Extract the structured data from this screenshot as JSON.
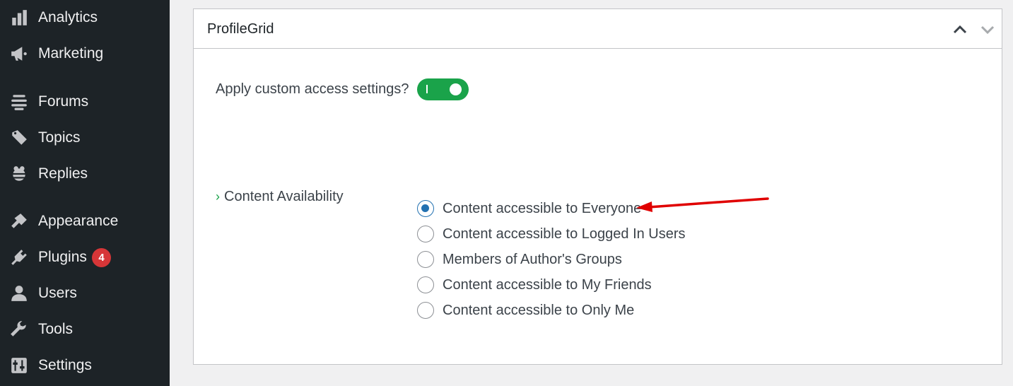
{
  "sidebar": {
    "items": [
      {
        "label": "Analytics",
        "icon": "bar-chart-icon"
      },
      {
        "label": "Marketing",
        "icon": "megaphone-icon"
      },
      {
        "label": "Forums",
        "icon": "forums-icon"
      },
      {
        "label": "Topics",
        "icon": "topics-icon"
      },
      {
        "label": "Replies",
        "icon": "replies-icon"
      },
      {
        "label": "Appearance",
        "icon": "paintbrush-icon"
      },
      {
        "label": "Plugins",
        "icon": "plug-icon",
        "badge": "4"
      },
      {
        "label": "Users",
        "icon": "user-icon"
      },
      {
        "label": "Tools",
        "icon": "wrench-icon"
      },
      {
        "label": "Settings",
        "icon": "settings-icon"
      }
    ]
  },
  "panel": {
    "title": "ProfileGrid",
    "toggle_label": "Apply custom access settings?",
    "toggle_on": true,
    "section_label": "Content Availability",
    "options": [
      {
        "label": "Content accessible to Everyone",
        "checked": true
      },
      {
        "label": "Content accessible to Logged In Users",
        "checked": false
      },
      {
        "label": "Members of Author's Groups",
        "checked": false
      },
      {
        "label": "Content accessible to My Friends",
        "checked": false
      },
      {
        "label": "Content accessible to Only Me",
        "checked": false
      }
    ]
  },
  "colors": {
    "sidebar_bg": "#1d2327",
    "toggle_on": "#1aa34a",
    "radio_checked": "#2271b1",
    "badge": "#d63638",
    "annotation_arrow": "#e00000"
  }
}
